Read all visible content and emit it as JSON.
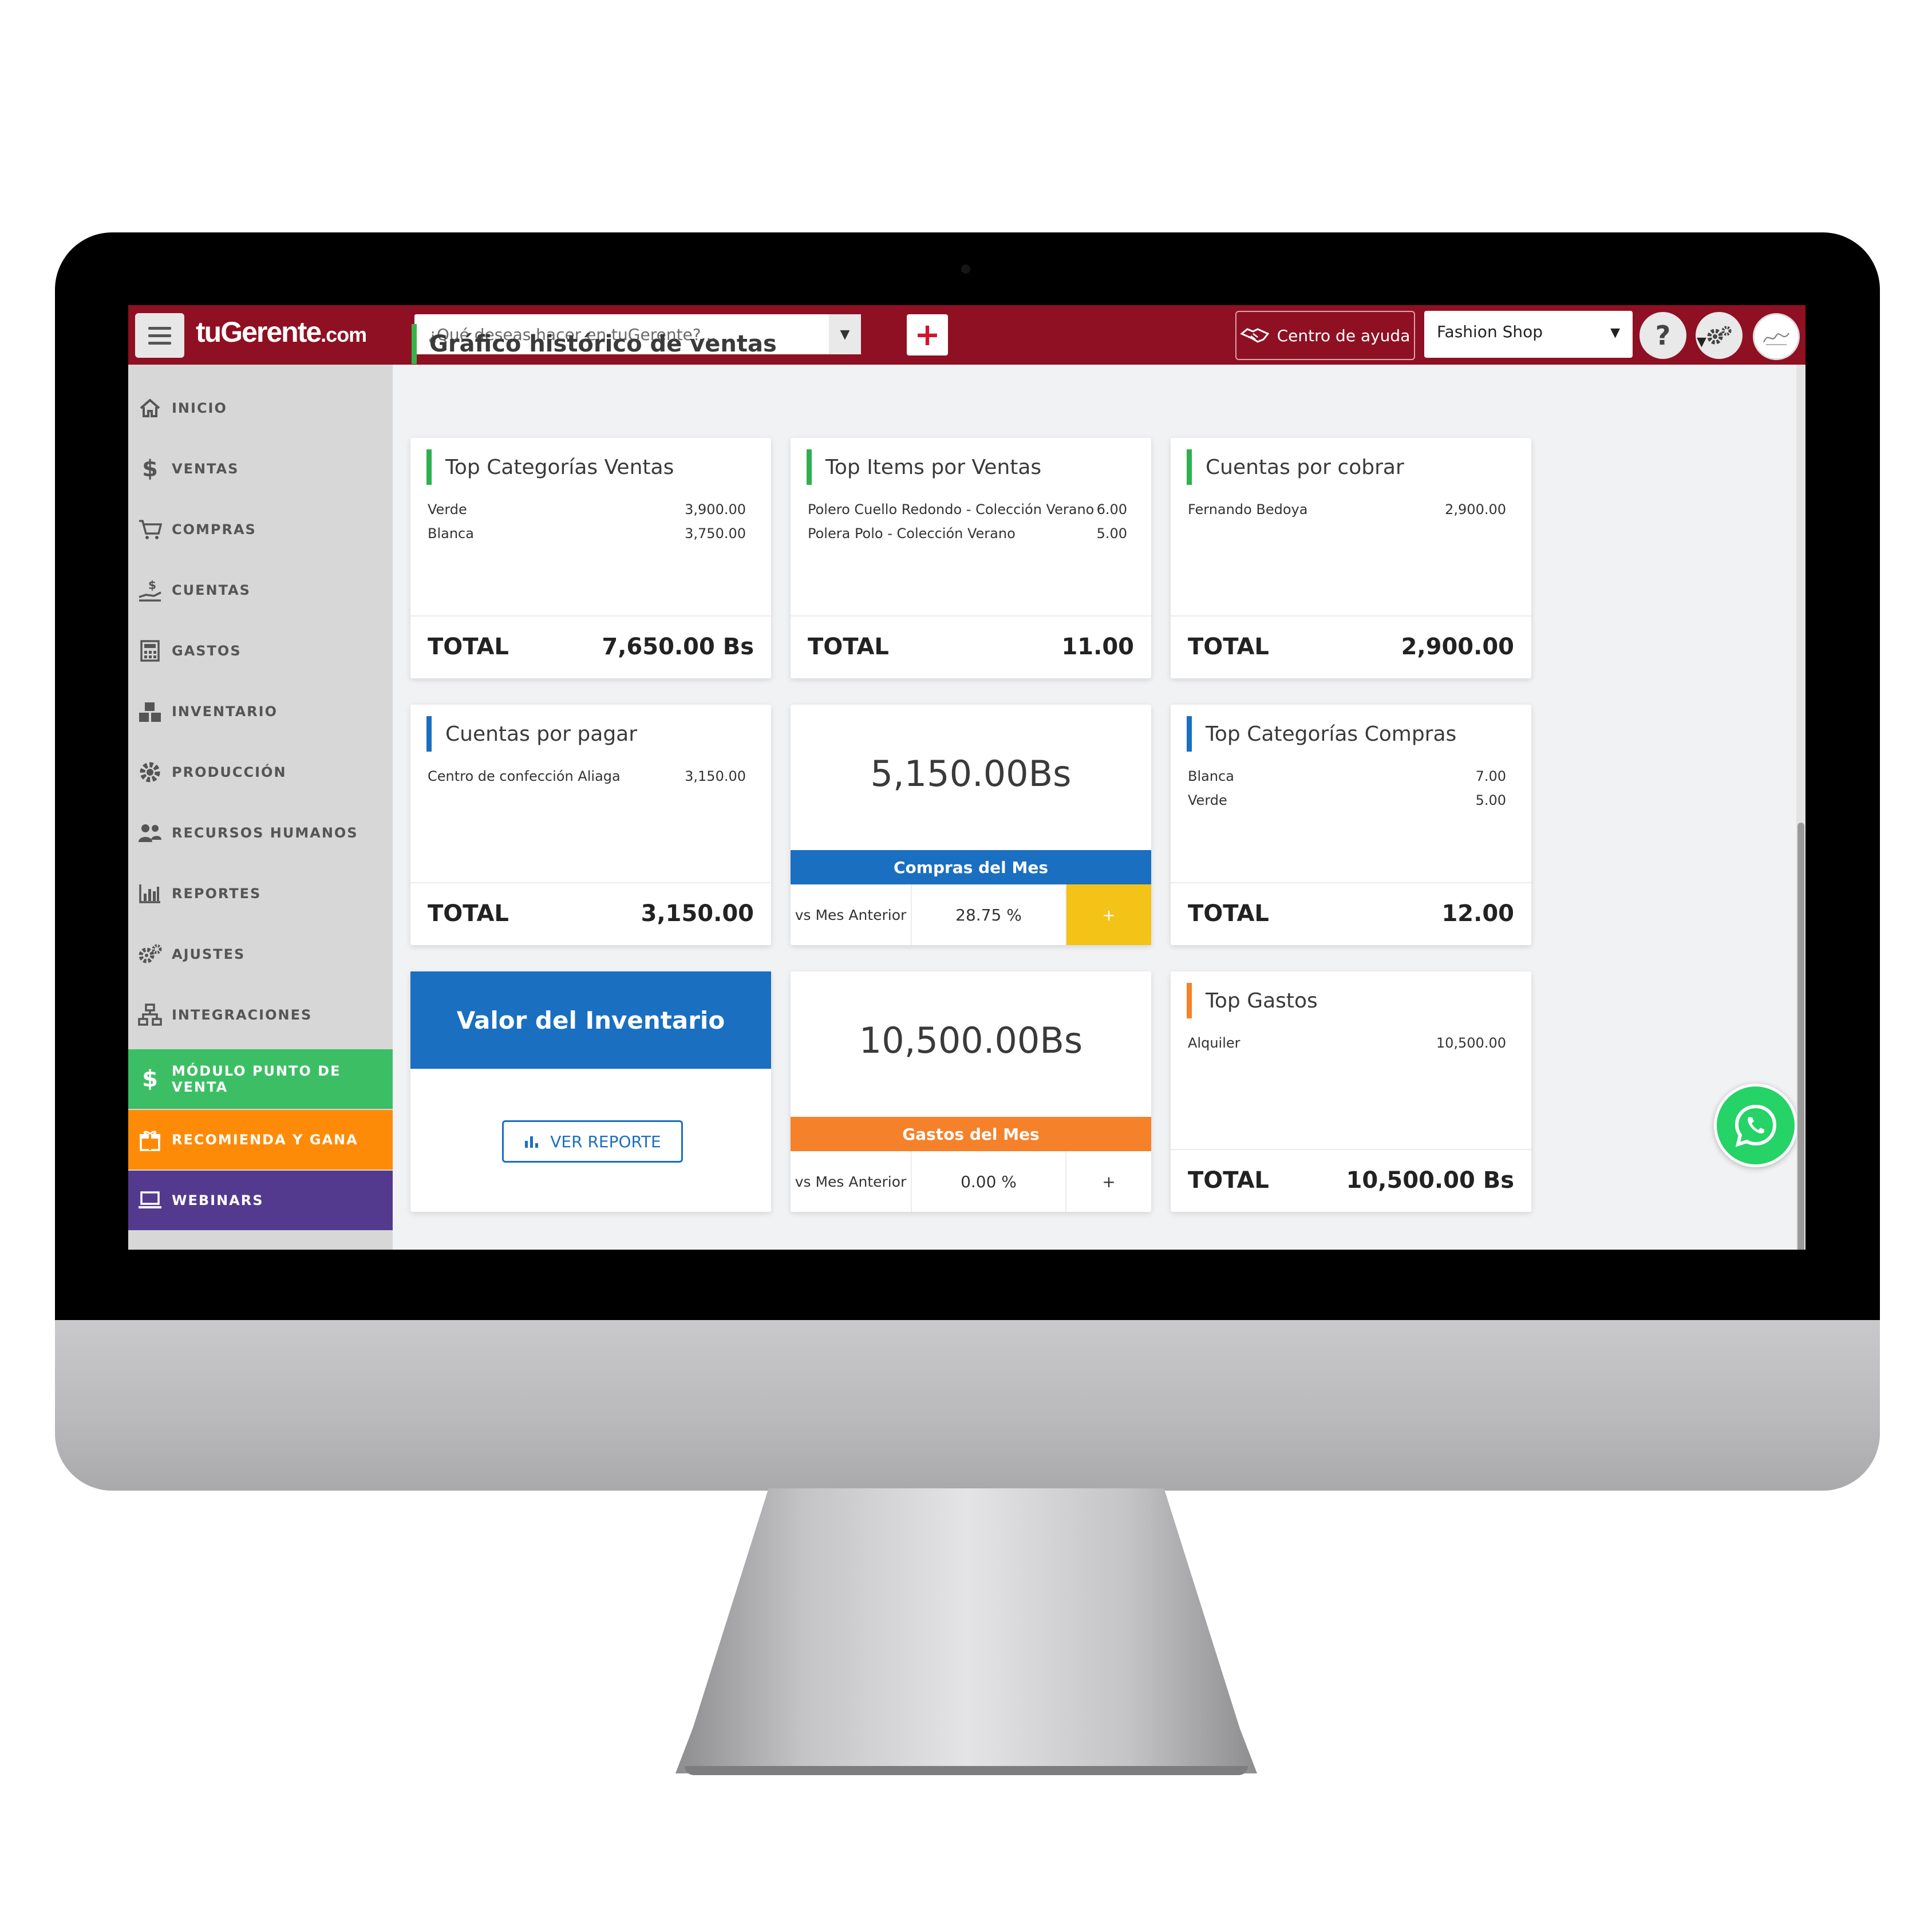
{
  "app": {
    "logo_main": "tuGerente",
    "logo_suffix": ".com"
  },
  "topbar": {
    "search_placeholder": "¿Qué deseas hacer en tuGerente?...",
    "add_label": "+",
    "help_center_label": "Centro de ayuda",
    "shop_selected": "Fashion Shop",
    "help_label": "?"
  },
  "sidebar": {
    "items": [
      {
        "label": "INICIO",
        "icon": "home-icon"
      },
      {
        "label": "VENTAS",
        "icon": "dollar-icon"
      },
      {
        "label": "COMPRAS",
        "icon": "cart-icon"
      },
      {
        "label": "CUENTAS",
        "icon": "hand-coin-icon"
      },
      {
        "label": "GASTOS",
        "icon": "calculator-icon"
      },
      {
        "label": "INVENTARIO",
        "icon": "boxes-icon"
      },
      {
        "label": "PRODUCCIÓN",
        "icon": "gear-icon"
      },
      {
        "label": "RECURSOS HUMANOS",
        "icon": "users-icon"
      },
      {
        "label": "REPORTES",
        "icon": "chart-icon"
      },
      {
        "label": "AJUSTES",
        "icon": "gears-icon"
      },
      {
        "label": "INTEGRACIONES",
        "icon": "network-icon"
      },
      {
        "label": "MÓDULO PUNTO DE VENTA",
        "icon": "dollar-icon",
        "color": "#3cbf64"
      },
      {
        "label": "RECOMIENDA Y GANA",
        "icon": "gift-icon",
        "color": "#fe8b07"
      },
      {
        "label": "WEBINARS",
        "icon": "laptop-icon",
        "color": "#543a8e"
      }
    ]
  },
  "main": {
    "section_title": "Gráfico histórico de ventas",
    "cards": {
      "top_categorias_ventas": {
        "title": "Top Categorías Ventas",
        "rows": [
          {
            "name": "Verde",
            "value": "3,900.00"
          },
          {
            "name": "Blanca",
            "value": "3,750.00"
          }
        ],
        "total_label": "TOTAL",
        "total_value": "7,650.00 Bs"
      },
      "top_items_ventas": {
        "title": "Top Items por Ventas",
        "rows": [
          {
            "name": "Polero Cuello Redondo - Colección Verano",
            "value": "6.00"
          },
          {
            "name": "Polera Polo - Colección Verano",
            "value": "5.00"
          }
        ],
        "total_label": "TOTAL",
        "total_value": "11.00"
      },
      "cuentas_cobrar": {
        "title": "Cuentas por cobrar",
        "rows": [
          {
            "name": "Fernando Bedoya",
            "value": "2,900.00"
          }
        ],
        "total_label": "TOTAL",
        "total_value": "2,900.00"
      },
      "cuentas_pagar": {
        "title": "Cuentas por pagar",
        "rows": [
          {
            "name": "Centro de confección Aliaga",
            "value": "3,150.00"
          }
        ],
        "total_label": "TOTAL",
        "total_value": "3,150.00"
      },
      "compras_mes": {
        "value": "5,150.00Bs",
        "band_label": "Compras del Mes",
        "compare_label": "vs Mes Anterior",
        "compare_value": "28.75 %",
        "compare_sign": "+",
        "accent_color": "#f3c317"
      },
      "top_categorias_compras": {
        "title": "Top Categorías Compras",
        "rows": [
          {
            "name": "Blanca",
            "value": "7.00"
          },
          {
            "name": "Verde",
            "value": "5.00"
          }
        ],
        "total_label": "TOTAL",
        "total_value": "12.00"
      },
      "valor_inventario": {
        "title": "Valor del Inventario",
        "button_label": "VER REPORTE"
      },
      "gastos_mes": {
        "value": "10,500.00Bs",
        "band_label": "Gastos del Mes",
        "compare_label": "vs Mes Anterior",
        "compare_value": "0.00 %",
        "compare_sign": "+"
      },
      "top_gastos": {
        "title": "Top Gastos",
        "rows": [
          {
            "name": "Alquiler",
            "value": "10,500.00"
          }
        ],
        "total_label": "TOTAL",
        "total_value": "10,500.00 Bs"
      }
    }
  },
  "colors": {
    "topbar": "#8f1022",
    "primary_blue": "#1a6fc0",
    "orange": "#f5812a",
    "green_bar": "#2eb04e",
    "whatsapp": "#25d366"
  }
}
